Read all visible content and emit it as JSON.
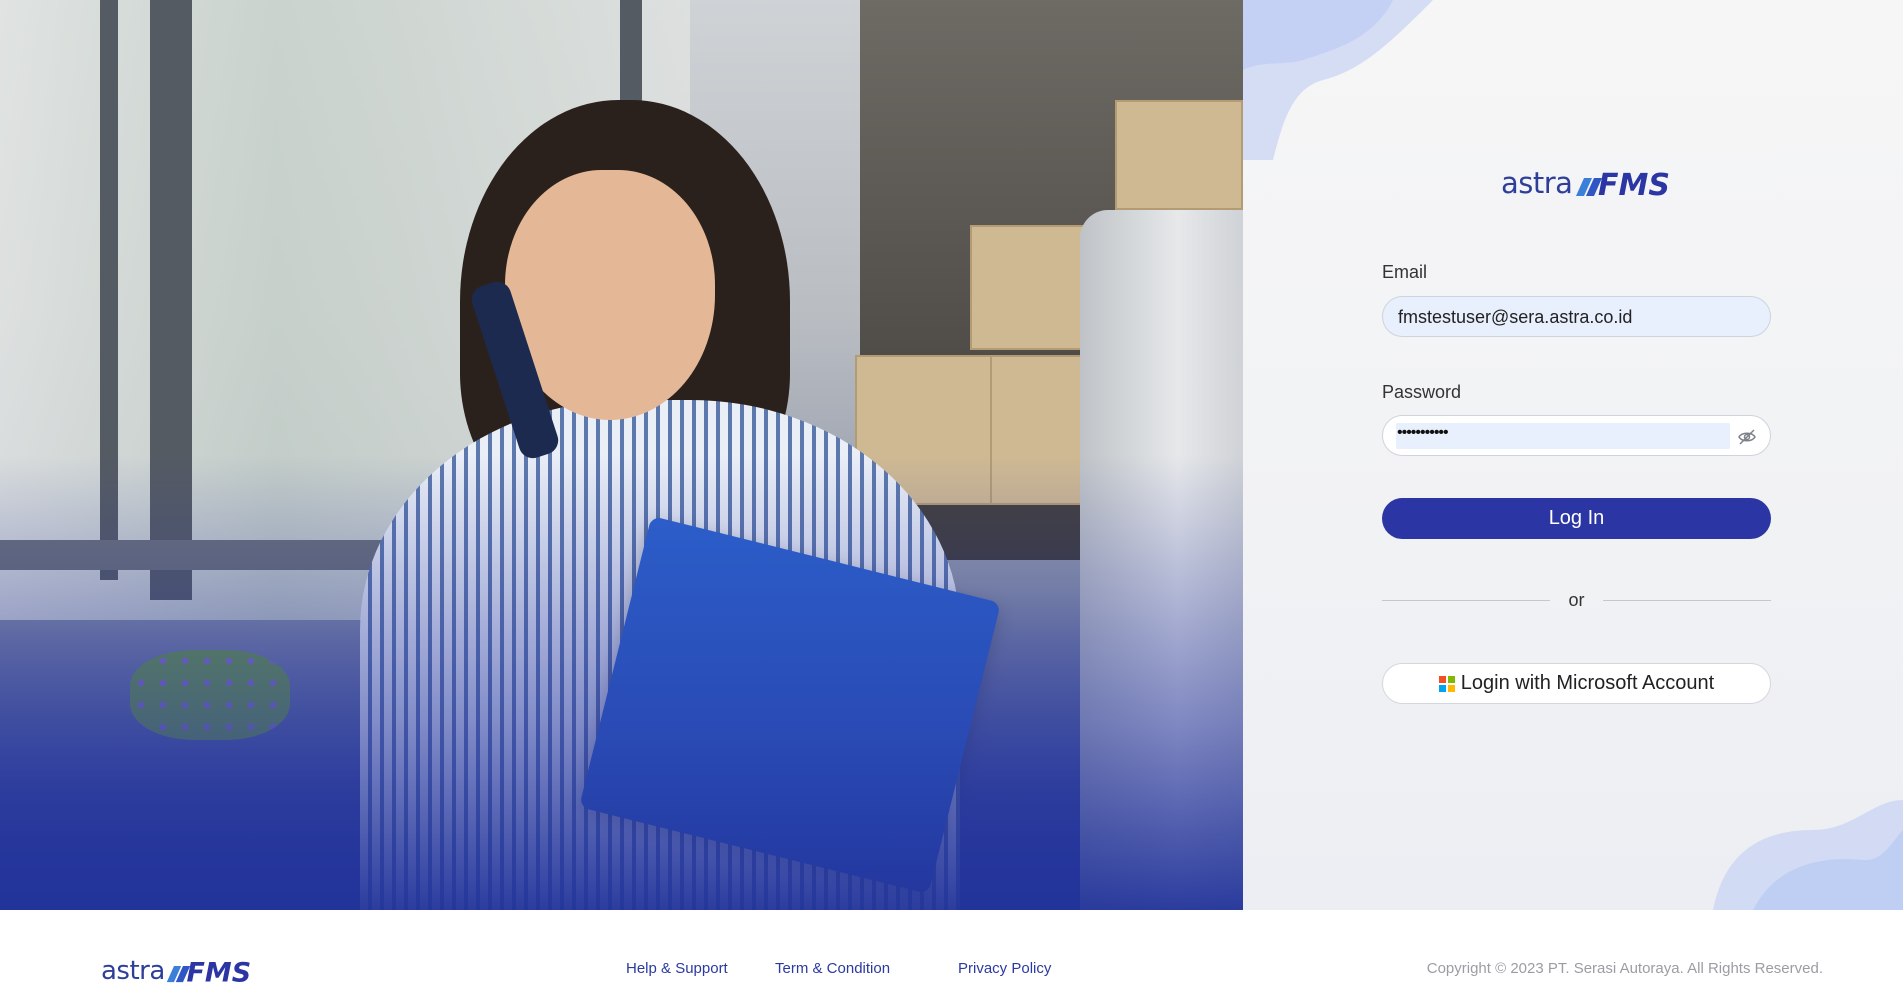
{
  "brand": {
    "logo_prefix": "astra",
    "logo_suffix": "FMS",
    "primary_color": "#2b35a3",
    "text_blue": "#2e3f9a"
  },
  "hero": {
    "image": "woman-on-phone-with-clipboard-photo"
  },
  "form": {
    "email_label": "Email",
    "email_value": "fmstestuser@sera.astra.co.id",
    "password_label": "Password",
    "password_value": "•••••••••••",
    "password_toggle_icon": "eye-slash-icon",
    "login_label": "Log In",
    "divider_label": "or",
    "microsoft_label": "Login with Microsoft Account",
    "microsoft_icon": "microsoft-logo-icon"
  },
  "footer": {
    "links": [
      {
        "label": "Help & Support"
      },
      {
        "label": "Term & Condition"
      },
      {
        "label": "Privacy Policy"
      }
    ],
    "copyright": "Copyright © 2023 PT. Serasi Autoraya. All Rights Reserved."
  }
}
